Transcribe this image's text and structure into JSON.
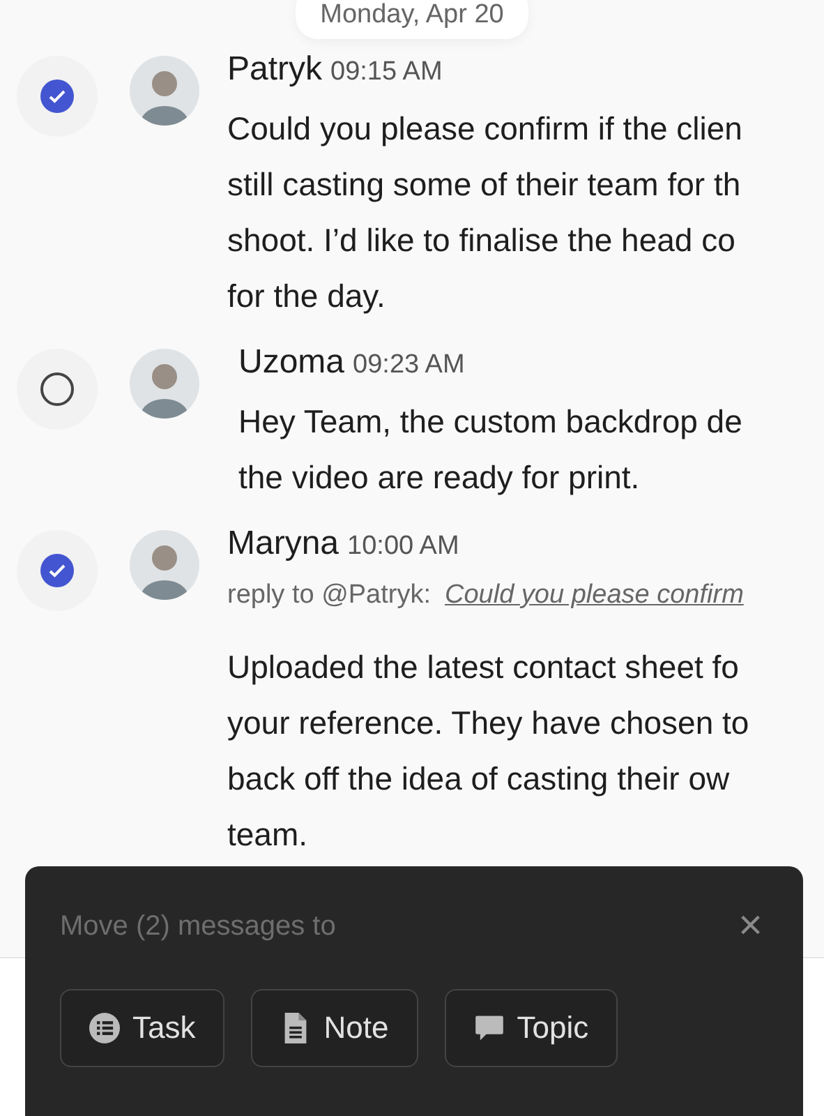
{
  "date_divider": "Monday, Apr 20",
  "messages": [
    {
      "author": "Patryk",
      "time": "09:15 AM",
      "selected": true,
      "lines": [
        "Could you please confirm if the clien",
        "still casting some of their team for th",
        "shoot. I’d like to finalise the head co",
        "for the day."
      ]
    },
    {
      "author": "Uzoma",
      "time": "09:23 AM",
      "selected": false,
      "lines": [
        "Hey Team, the custom backdrop de",
        "the video are ready for print."
      ]
    },
    {
      "author": "Maryna",
      "time": "10:00 AM",
      "selected": true,
      "reply": {
        "label": "reply to @Patryk:",
        "quote": "Could you please confirm"
      },
      "lines": [
        "Uploaded the latest contact sheet fo",
        "your reference. They have chosen to",
        "back off the idea of casting their ow",
        "team."
      ]
    }
  ],
  "move_panel": {
    "title": "Move (2) messages to",
    "close": "×",
    "buttons": [
      {
        "kind": "task",
        "label": "Task"
      },
      {
        "kind": "note",
        "label": "Note"
      },
      {
        "kind": "topic",
        "label": "Topic"
      }
    ]
  }
}
